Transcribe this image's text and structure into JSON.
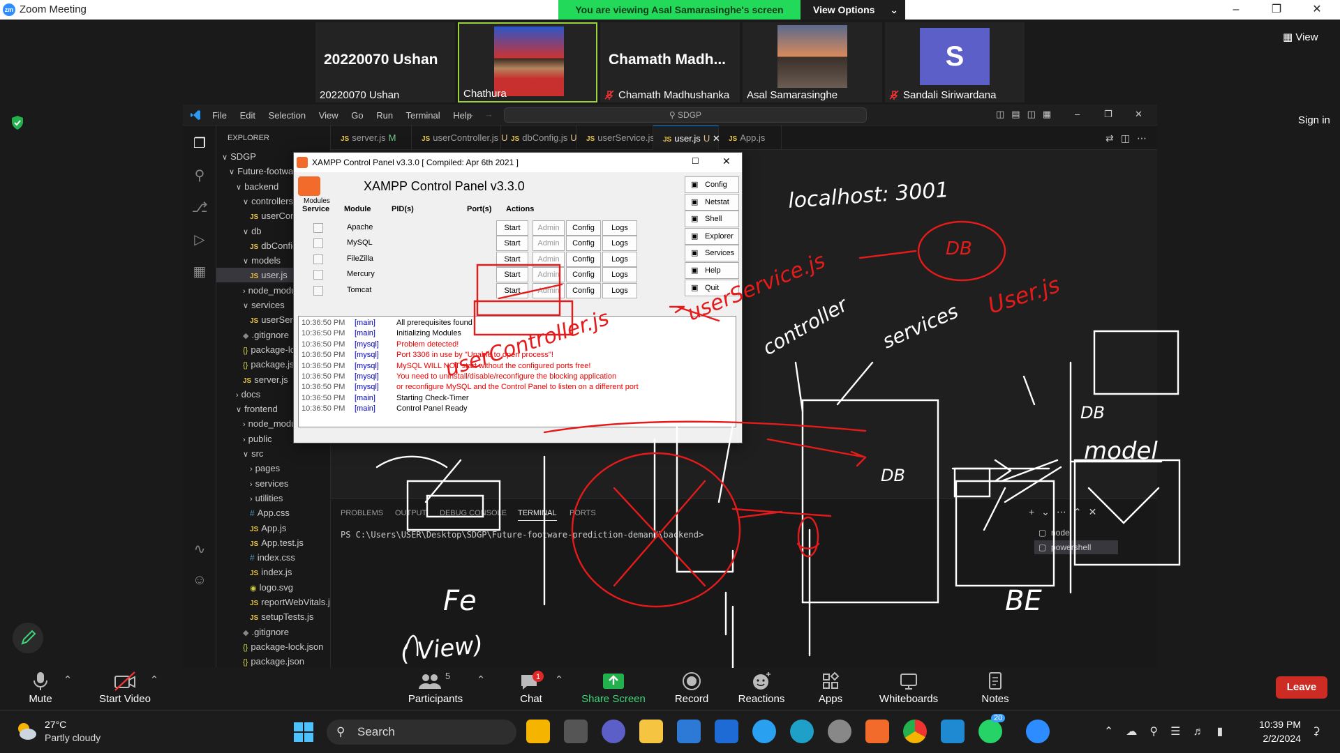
{
  "zoom": {
    "window_title": "Zoom Meeting",
    "banner_text": "You are viewing Asal Samarasinghe's screen",
    "view_options_label": "View Options",
    "view_label": "View",
    "sign_in_label": "Sign in",
    "participants": [
      {
        "big_text": "20220070 Ushan",
        "name": "20220070 Ushan",
        "muted": false
      },
      {
        "big_text": "",
        "name": "Chathura",
        "muted": false
      },
      {
        "big_text": "Chamath  Madh...",
        "name": "Chamath Madhushanka",
        "muted": true
      },
      {
        "big_text": "",
        "name": "Asal Samarasinghe",
        "muted": false
      },
      {
        "big_text": "S",
        "name": "Sandali Siriwardana",
        "muted": true
      }
    ],
    "toolbar": {
      "mute": "Mute",
      "start_video": "Start Video",
      "participants": "Participants",
      "participants_count": "5",
      "chat": "Chat",
      "chat_badge": "1",
      "share_screen": "Share Screen",
      "record": "Record",
      "reactions": "Reactions",
      "apps": "Apps",
      "whiteboards": "Whiteboards",
      "notes": "Notes",
      "leave": "Leave"
    }
  },
  "vscode": {
    "menu": [
      "File",
      "Edit",
      "Selection",
      "View",
      "Go",
      "Run",
      "Terminal",
      "Help"
    ],
    "search_text": "SDGP",
    "explorer_title": "EXPLORER",
    "project": "SDGP",
    "tree": [
      {
        "label": "SDGP",
        "kind": "folder-open",
        "depth": 0
      },
      {
        "label": "Future-footwa",
        "kind": "folder-open",
        "depth": 1
      },
      {
        "label": "backend",
        "kind": "folder-open",
        "depth": 2
      },
      {
        "label": "controllers",
        "kind": "folder-open",
        "depth": 3
      },
      {
        "label": "userContr",
        "kind": "js",
        "depth": 4
      },
      {
        "label": "db",
        "kind": "folder-open",
        "depth": 3
      },
      {
        "label": "dbConfig.",
        "kind": "js",
        "depth": 4
      },
      {
        "label": "models",
        "kind": "folder-open",
        "depth": 3
      },
      {
        "label": "user.js",
        "kind": "js",
        "depth": 4,
        "selected": true
      },
      {
        "label": "node_modu",
        "kind": "folder",
        "depth": 3
      },
      {
        "label": "services",
        "kind": "folder-open",
        "depth": 3
      },
      {
        "label": "userServic",
        "kind": "js",
        "depth": 4
      },
      {
        "label": ".gitignore",
        "kind": "git",
        "depth": 3
      },
      {
        "label": "package-lo",
        "kind": "json",
        "depth": 3
      },
      {
        "label": "package.jso",
        "kind": "json",
        "depth": 3
      },
      {
        "label": "server.js",
        "kind": "js",
        "depth": 3
      },
      {
        "label": "docs",
        "kind": "folder",
        "depth": 2
      },
      {
        "label": "frontend",
        "kind": "folder-open",
        "depth": 2
      },
      {
        "label": "node_modu",
        "kind": "folder",
        "depth": 3
      },
      {
        "label": "public",
        "kind": "folder",
        "depth": 3
      },
      {
        "label": "src",
        "kind": "folder-open",
        "depth": 3
      },
      {
        "label": "pages",
        "kind": "folder",
        "depth": 4
      },
      {
        "label": "services",
        "kind": "folder",
        "depth": 4
      },
      {
        "label": "utilities",
        "kind": "folder",
        "depth": 4
      },
      {
        "label": "App.css",
        "kind": "css",
        "depth": 4
      },
      {
        "label": "App.js",
        "kind": "js",
        "depth": 4
      },
      {
        "label": "App.test.js",
        "kind": "js",
        "depth": 4
      },
      {
        "label": "index.css",
        "kind": "css",
        "depth": 4
      },
      {
        "label": "index.js",
        "kind": "js",
        "depth": 4
      },
      {
        "label": "logo.svg",
        "kind": "svg",
        "depth": 4
      },
      {
        "label": "reportWebVitals.js",
        "kind": "js",
        "depth": 4
      },
      {
        "label": "setupTests.js",
        "kind": "js",
        "depth": 4
      },
      {
        "label": ".gitignore",
        "kind": "git",
        "depth": 3
      },
      {
        "label": "package-lock.json",
        "kind": "json",
        "depth": 3
      },
      {
        "label": "package.json",
        "kind": "json",
        "depth": 3
      }
    ],
    "tabs": [
      {
        "label": "server.js",
        "status": "M",
        "active": false
      },
      {
        "label": "userController.js",
        "status": "U",
        "active": false
      },
      {
        "label": "dbConfig.js",
        "status": "U",
        "active": false
      },
      {
        "label": "userService.js",
        "status": "U",
        "active": false
      },
      {
        "label": "user.js",
        "status": "U",
        "active": true
      },
      {
        "label": "App.js",
        "status": "",
        "active": false
      }
    ],
    "panel_tabs": [
      "PROBLEMS",
      "OUTPUT",
      "DEBUG CONSOLE",
      "TERMINAL",
      "PORTS"
    ],
    "terminal_prompt": "PS C:\\Users\\USER\\Desktop\\SDGP\\Future-footware-prediction-demand\\backend>",
    "terminals": [
      "node",
      "powershell"
    ]
  },
  "xampp": {
    "title": "XAMPP Control Panel v3.3.0   [ Compiled: Apr 6th 2021 ]",
    "heading": "XAMPP Control Panel v3.3.0",
    "modules_label": "Modules",
    "columns": [
      "Service",
      "Module",
      "PID(s)",
      "Port(s)",
      "Actions"
    ],
    "modules": [
      "Apache",
      "MySQL",
      "FileZilla",
      "Mercury",
      "Tomcat"
    ],
    "actions": [
      "Start",
      "Admin",
      "Config",
      "Logs"
    ],
    "side_buttons": [
      "Config",
      "Netstat",
      "Shell",
      "Explorer",
      "Services",
      "Help",
      "Quit"
    ],
    "log": [
      {
        "time": "10:36:50 PM",
        "module": "[main]",
        "text": "All prerequisites found",
        "error": false
      },
      {
        "time": "10:36:50 PM",
        "module": "[main]",
        "text": "Initializing Modules",
        "error": false
      },
      {
        "time": "10:36:50 PM",
        "module": "[mysql]",
        "text": "Problem detected!",
        "error": true
      },
      {
        "time": "10:36:50 PM",
        "module": "[mysql]",
        "text": "Port 3306 in use by \"Unable to open process\"!",
        "error": true
      },
      {
        "time": "10:36:50 PM",
        "module": "[mysql]",
        "text": "MySQL WILL NOT start without the configured ports free!",
        "error": true
      },
      {
        "time": "10:36:50 PM",
        "module": "[mysql]",
        "text": "You need to uninstall/disable/reconfigure the blocking application",
        "error": true
      },
      {
        "time": "10:36:50 PM",
        "module": "[mysql]",
        "text": "or reconfigure MySQL and the Control Panel to listen on a different port",
        "error": true
      },
      {
        "time": "10:36:50 PM",
        "module": "[main]",
        "text": "Starting Check-Timer",
        "error": false
      },
      {
        "time": "10:36:50 PM",
        "module": "[main]",
        "text": "Control Panel Ready",
        "error": false
      }
    ]
  },
  "annotations": {
    "localhost": "localhost: 3001",
    "db_top": "DB",
    "userservice": "userService.js",
    "userjs": "User.js",
    "controller": "controller",
    "services": "services",
    "usercontroller": "userController.js",
    "db_small": "DB",
    "db_model": "DB",
    "model": "model",
    "fe": "Fe",
    "view": "( View)",
    "be": "BE"
  },
  "taskbar": {
    "weather_temp": "27°C",
    "weather_desc": "Partly cloudy",
    "search": "Search",
    "time": "10:39 PM",
    "date": "2/2/2024",
    "whatsapp_badge": "20"
  }
}
